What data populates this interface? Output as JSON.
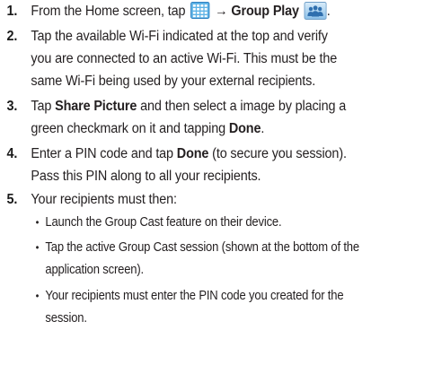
{
  "steps": [
    {
      "number": "1.",
      "prefix": "From the Home screen, tap",
      "arrow": "→",
      "bold": "Group Play",
      "end": "."
    },
    {
      "number": "2.",
      "lines": [
        "Tap the available Wi-Fi indicated at the top and verify",
        "you are connected to an active Wi-Fi. This must be the",
        "same Wi-Fi being used by your external recipients."
      ]
    },
    {
      "number": "3.",
      "l1_pre": "Tap ",
      "l1_bold": "Share Picture",
      "l1_post": " and then select a image by placing a",
      "l2_pre": "green checkmark on it and tapping ",
      "l2_bold": "Done",
      "l2_post": "."
    },
    {
      "number": "4.",
      "l1_pre": "Enter a PIN code and tap ",
      "l1_bold": "Done",
      "l1_post": " (to secure you session).",
      "l2": "Pass this PIN along to all your recipients."
    },
    {
      "number": "5.",
      "text": "Your recipients must then:",
      "bullets": [
        {
          "lines": [
            "Launch the Group Cast feature on their device."
          ]
        },
        {
          "lines": [
            "Tap the active Group Cast session (shown at the bottom of the",
            "application screen)."
          ]
        },
        {
          "lines": [
            "Your recipients must enter the PIN code you created for the",
            "session."
          ]
        }
      ]
    }
  ],
  "bullet_glyph": "•",
  "icons": {
    "apps": "apps-grid-icon",
    "group_play": "group-play-icon"
  },
  "colors": {
    "text": "#231f20",
    "apps_icon": "#4aa3df",
    "group_play_icon": "#3f86c4"
  }
}
